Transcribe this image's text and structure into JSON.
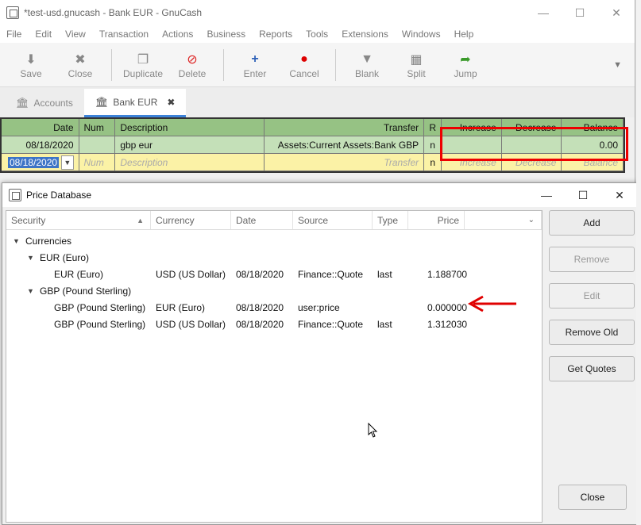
{
  "main": {
    "title": "*test-usd.gnucash - Bank EUR - GnuCash",
    "menu": [
      "File",
      "Edit",
      "View",
      "Transaction",
      "Actions",
      "Business",
      "Reports",
      "Tools",
      "Extensions",
      "Windows",
      "Help"
    ],
    "toolbar": {
      "save": "Save",
      "close": "Close",
      "duplicate": "Duplicate",
      "delete": "Delete",
      "enter": "Enter",
      "cancel": "Cancel",
      "blank": "Blank",
      "split": "Split",
      "jump": "Jump"
    },
    "tabs": {
      "accounts": "Accounts",
      "bank_eur": "Bank EUR"
    },
    "register": {
      "headers": {
        "date": "Date",
        "num": "Num",
        "description": "Description",
        "transfer": "Transfer",
        "r": "R",
        "increase": "Increase",
        "decrease": "Decrease",
        "balance": "Balance"
      },
      "entry": {
        "date": "08/18/2020",
        "num": "",
        "description": "gbp eur",
        "transfer": "Assets:Current Assets:Bank GBP",
        "r": "n",
        "increase": "",
        "decrease": "",
        "balance": "0.00"
      },
      "blank": {
        "date": "08/18/2020",
        "num": "Num",
        "description": "Description",
        "transfer": "Transfer",
        "r": "n",
        "increase": "Increase",
        "decrease": "Decrease",
        "balance": "Balance"
      }
    }
  },
  "dialog": {
    "title": "Price Database",
    "columns": {
      "security": "Security",
      "currency": "Currency",
      "date": "Date",
      "source": "Source",
      "type": "Type",
      "price": "Price"
    },
    "tree": {
      "root": "Currencies",
      "eur_group": "EUR (Euro)",
      "eur_row": {
        "security": "EUR (Euro)",
        "currency": "USD (US Dollar)",
        "date": "08/18/2020",
        "source": "Finance::Quote",
        "type": "last",
        "price": "1.188700"
      },
      "gbp_group": "GBP (Pound Sterling)",
      "gbp_row1": {
        "security": "GBP (Pound Sterling)",
        "currency": "EUR (Euro)",
        "date": "08/18/2020",
        "source": "user:price",
        "type": "",
        "price": "0.000000"
      },
      "gbp_row2": {
        "security": "GBP (Pound Sterling)",
        "currency": "USD (US Dollar)",
        "date": "08/18/2020",
        "source": "Finance::Quote",
        "type": "last",
        "price": "1.312030"
      }
    },
    "buttons": {
      "add": "Add",
      "remove": "Remove",
      "edit": "Edit",
      "remove_old": "Remove Old",
      "get_quotes": "Get Quotes",
      "close": "Close"
    }
  },
  "colors": {
    "annotation_red": "#e00000",
    "register_header": "#96c284",
    "register_entry": "#c4e0b8",
    "register_blank": "#fbf2a6"
  }
}
